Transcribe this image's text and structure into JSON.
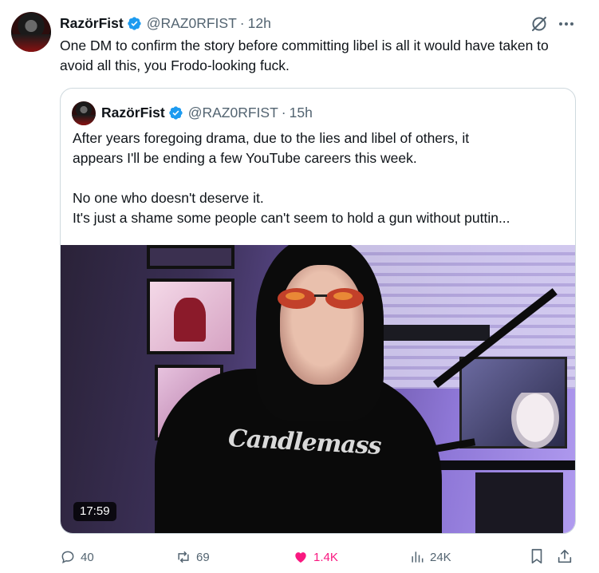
{
  "tweet": {
    "author_name": "RazörFist",
    "handle": "@RAZ0RFIST",
    "separator": "·",
    "time": "12h",
    "text": "One DM to confirm the story before committing libel is all it would have taken to avoid all this, you Frodo-looking fuck."
  },
  "quote": {
    "author_name": "RazörFist",
    "handle": "@RAZ0RFIST",
    "separator": "·",
    "time": "15h",
    "lines": [
      "After years foregoing drama, due to the lies and libel of others, it",
      "appears I'll be ending a few YouTube careers this week.",
      "",
      "No one who doesn't deserve it.",
      "It's just a shame some people can't seem to hold a gun without puttin..."
    ],
    "video": {
      "duration": "17:59",
      "shirt_text": "Candlemass"
    }
  },
  "actions": {
    "replies": "40",
    "reposts": "69",
    "likes": "1.4K",
    "views": "24K"
  },
  "icons": {
    "verified": "verified-badge-icon",
    "grok": "grok-icon",
    "more": "more-icon",
    "reply": "reply-icon",
    "repost": "repost-icon",
    "like": "heart-icon",
    "views": "views-icon",
    "bookmark": "bookmark-icon",
    "share": "share-icon"
  },
  "colors": {
    "verified": "#1d9bf0",
    "like": "#f91880",
    "muted": "#536471",
    "text": "#0f1419",
    "border": "#cfd9de"
  }
}
